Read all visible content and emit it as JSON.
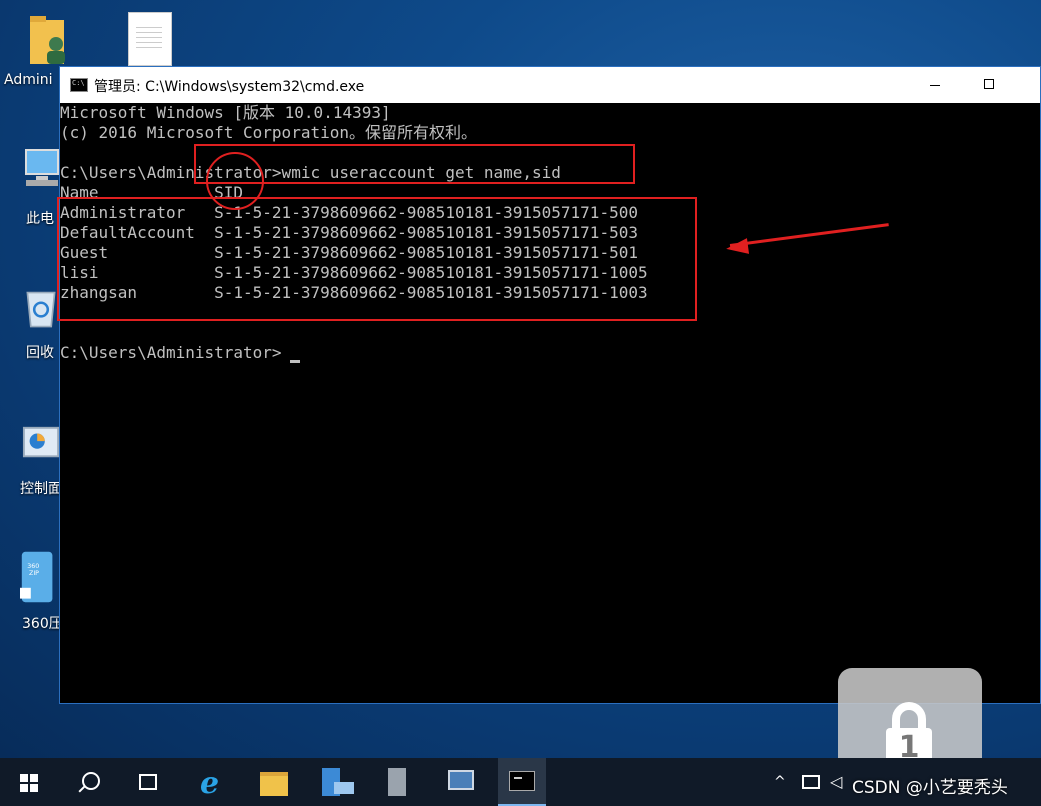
{
  "desktop": {
    "icons": [
      {
        "label": "Admini"
      },
      {
        "label": ""
      },
      {
        "label": "此电"
      },
      {
        "label": "回收"
      },
      {
        "label": "控制面"
      },
      {
        "label": "360压"
      }
    ]
  },
  "window": {
    "title": "管理员: C:\\Windows\\system32\\cmd.exe",
    "minimize_icon": "minimize-icon",
    "maximize_icon": "maximize-icon"
  },
  "console": {
    "lines": [
      "Microsoft Windows [版本 10.0.14393]",
      "(c) 2016 Microsoft Corporation。保留所有权利。",
      "",
      "C:\\Users\\Administrator>wmic useraccount get name,sid",
      "Name            SID",
      "Administrator   S-1-5-21-3798609662-908510181-3915057171-500",
      "DefaultAccount  S-1-5-21-3798609662-908510181-3915057171-503",
      "Guest           S-1-5-21-3798609662-908510181-3915057171-501",
      "lisi            S-1-5-21-3798609662-908510181-3915057171-1005",
      "zhangsan        S-1-5-21-3798609662-908510181-3915057171-1003",
      "",
      "",
      "C:\\Users\\Administrator>"
    ]
  },
  "annotations": {
    "color": "#e02020"
  },
  "lock_overlay": {
    "number": "1"
  },
  "taskbar": {
    "items": [
      "start-icon",
      "search-icon",
      "task-view-icon",
      "ie-icon",
      "file-explorer-icon",
      "server-manager-icon",
      "admin-tools-icon",
      "network-icon",
      "cmd-icon"
    ],
    "tray": {
      "up_arrow": "^",
      "volume": "◁"
    }
  },
  "watermark": "CSDN @小艺要秃头"
}
